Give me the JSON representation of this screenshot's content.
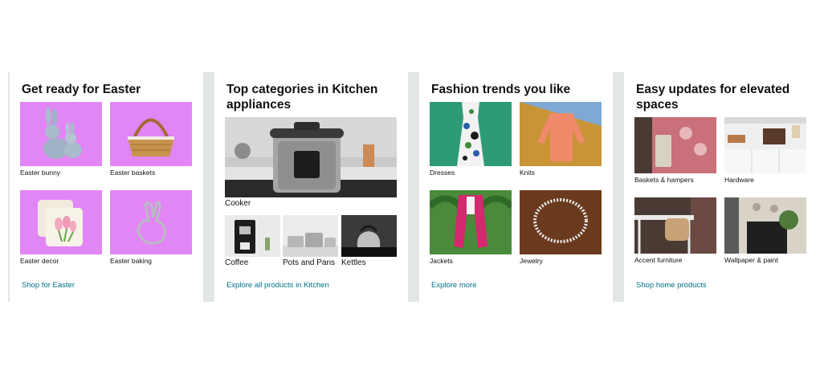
{
  "cards": [
    {
      "title": "Get ready for Easter",
      "link": "Shop for Easter",
      "items": [
        {
          "label": "Easter bunny",
          "icon": "easter-bunny-image"
        },
        {
          "label": "Easter baskets",
          "icon": "easter-basket-image"
        },
        {
          "label": "Easter decor",
          "icon": "easter-pillow-image"
        },
        {
          "label": "Easter baking",
          "icon": "bunny-cookie-cutter-image"
        }
      ]
    },
    {
      "title": "Top categories in Kitchen appliances",
      "link": "Explore all products in Kitchen",
      "feature": {
        "label": "Cooker",
        "icon": "pressure-cooker-image"
      },
      "items": [
        {
          "label": "Coffee",
          "icon": "coffee-maker-image"
        },
        {
          "label": "Pots and Pans",
          "icon": "pots-pans-image"
        },
        {
          "label": "Kettles",
          "icon": "kettle-image"
        }
      ]
    },
    {
      "title": "Fashion trends you like",
      "link": "Explore more",
      "items": [
        {
          "label": "Dresses",
          "icon": "dress-image"
        },
        {
          "label": "Knits",
          "icon": "knit-top-image"
        },
        {
          "label": "Jackets",
          "icon": "jacket-image"
        },
        {
          "label": "Jewelry",
          "icon": "necklace-image"
        }
      ]
    },
    {
      "title": "Easy updates for elevated spaces",
      "link": "Shop home products",
      "items": [
        {
          "label": "Baskets & hampers",
          "icon": "hamper-image"
        },
        {
          "label": "Hardware",
          "icon": "cabinet-hardware-image"
        },
        {
          "label": "Accent furniture",
          "icon": "desk-furniture-image"
        },
        {
          "label": "Wallpaper & paint",
          "icon": "wallpaper-image"
        }
      ]
    }
  ],
  "colors": {
    "link": "#007185",
    "divider": "#e3e6e6",
    "easter_bg": "#e285f5"
  }
}
